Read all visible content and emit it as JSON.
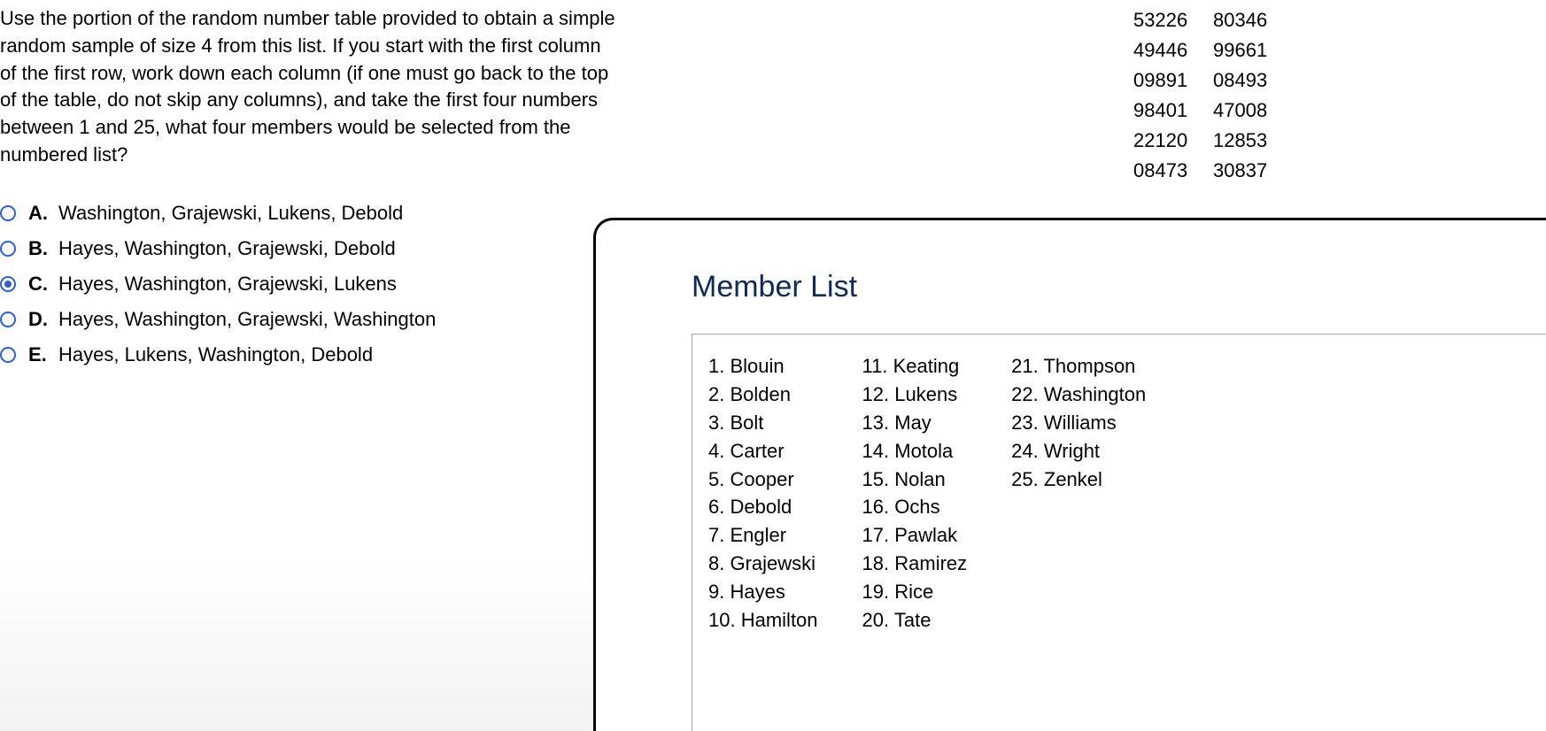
{
  "question": "Use the portion of the random number table provided to obtain a simple random sample of size 4 from this list. If you start with the first column of the first row, work down each column (if one must go back to the top of the table, do not skip any columns), and take the first four numbers between 1 and 25, what four members would be selected from the numbered list?",
  "random_table": [
    [
      "53226",
      "80346"
    ],
    [
      "49446",
      "99661"
    ],
    [
      "09891",
      "08493"
    ],
    [
      "98401",
      "47008"
    ],
    [
      "22120",
      "12853"
    ],
    [
      "08473",
      "30837"
    ]
  ],
  "choices": [
    {
      "letter": "A.",
      "text": "Washington, Grajewski, Lukens, Debold",
      "selected": false
    },
    {
      "letter": "B.",
      "text": "Hayes, Washington, Grajewski, Debold",
      "selected": false
    },
    {
      "letter": "C.",
      "text": "Hayes, Washington, Grajewski, Lukens",
      "selected": true
    },
    {
      "letter": "D.",
      "text": "Hayes, Washington, Grajewski, Washington",
      "selected": false
    },
    {
      "letter": "E.",
      "text": "Hayes, Lukens, Washington, Debold",
      "selected": false
    }
  ],
  "popup": {
    "title": "Member List",
    "members": [
      {
        "n": "1.",
        "name": "Blouin"
      },
      {
        "n": "2.",
        "name": "Bolden"
      },
      {
        "n": "3.",
        "name": "Bolt"
      },
      {
        "n": "4.",
        "name": "Carter"
      },
      {
        "n": "5.",
        "name": "Cooper"
      },
      {
        "n": "6.",
        "name": "Debold"
      },
      {
        "n": "7.",
        "name": "Engler"
      },
      {
        "n": "8.",
        "name": "Grajewski"
      },
      {
        "n": "9.",
        "name": "Hayes"
      },
      {
        "n": "10.",
        "name": "Hamilton"
      },
      {
        "n": "11.",
        "name": "Keating"
      },
      {
        "n": "12.",
        "name": "Lukens"
      },
      {
        "n": "13.",
        "name": "May"
      },
      {
        "n": "14.",
        "name": "Motola"
      },
      {
        "n": "15.",
        "name": "Nolan"
      },
      {
        "n": "16.",
        "name": "Ochs"
      },
      {
        "n": "17.",
        "name": "Pawlak"
      },
      {
        "n": "18.",
        "name": "Ramirez"
      },
      {
        "n": "19.",
        "name": "Rice"
      },
      {
        "n": "20.",
        "name": "Tate"
      },
      {
        "n": "21.",
        "name": "Thompson"
      },
      {
        "n": "22.",
        "name": "Washington"
      },
      {
        "n": "23.",
        "name": "Williams"
      },
      {
        "n": "24.",
        "name": "Wright"
      },
      {
        "n": "25.",
        "name": "Zenkel"
      }
    ]
  }
}
